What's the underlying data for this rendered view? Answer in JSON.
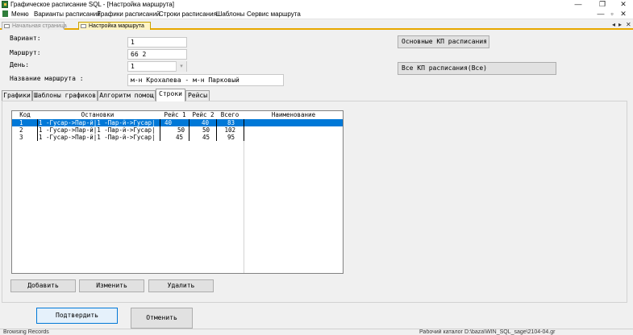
{
  "window": {
    "title": "Графическое расписание SQL - [Настройка маршрута]",
    "controls": {
      "minimize": "—",
      "restore": "❐",
      "close": "✕"
    }
  },
  "menu": [
    "Меню",
    "Варианты расписаний",
    "Графики расписаний",
    "Строки расписания",
    "Шаблоны",
    "Сервис маршрута"
  ],
  "mdi_controls": {
    "minimize": "—",
    "restore": "▫",
    "close": "✕"
  },
  "doc_tabs": [
    {
      "label": "Начальная страница",
      "active": false
    },
    {
      "label": "Настройка маршрута",
      "active": true
    }
  ],
  "doc_nav": {
    "prev": "◂",
    "next": "▸",
    "close": "✕"
  },
  "form": {
    "variant_label": "Вариант:",
    "variant_value": "1",
    "route_label": "Маршрут:",
    "route_value": "66  2",
    "day_label": "День:",
    "day_value": "1",
    "route_name_label": "Название маршрута :",
    "route_name_value": "м-н Крохалева - м-н Парковый"
  },
  "side_buttons": {
    "main_kp": "Основные КП расписания",
    "all_kp": "Все КП расписания(Все)"
  },
  "tabs": [
    "Графики",
    "Шаблоны графиков",
    "Алгоритм помощ",
    "Строки",
    "Рейсы"
  ],
  "active_tab": "Строки",
  "grid": {
    "columns": [
      "Код",
      "Остановки",
      "Рейс 1",
      "Рейс 2",
      "Всего",
      "Наименование"
    ],
    "rows": [
      {
        "code": "1",
        "stops": "1 -Гусар->Пар-й|1 -Пар-й->Гусар|",
        "trip1": "40",
        "trip2": "40",
        "total": "83",
        "name": "",
        "selected": true
      },
      {
        "code": "2",
        "stops": "1 -Гусар->Пар-й|1 -Пар-й->Гусар|",
        "trip1": "50",
        "trip2": "50",
        "total": "102",
        "name": "",
        "selected": false
      },
      {
        "code": "3",
        "stops": "1 -Гусар->Пар-й|1 -Пар-й->Гусар|",
        "trip1": "45",
        "trip2": "45",
        "total": "95",
        "name": "",
        "selected": false
      }
    ],
    "selection_color": "#0078d7"
  },
  "grid_buttons": {
    "add": "Добавить",
    "edit": "Изменить",
    "delete": "Удалить"
  },
  "footer_buttons": {
    "confirm": "Подтвердить",
    "cancel": "Отменить"
  },
  "status": {
    "left": "Browsing Records",
    "right": "Рабочий каталог D:\\baza\\WIN_SQL_sage\\2104-04.gr"
  }
}
